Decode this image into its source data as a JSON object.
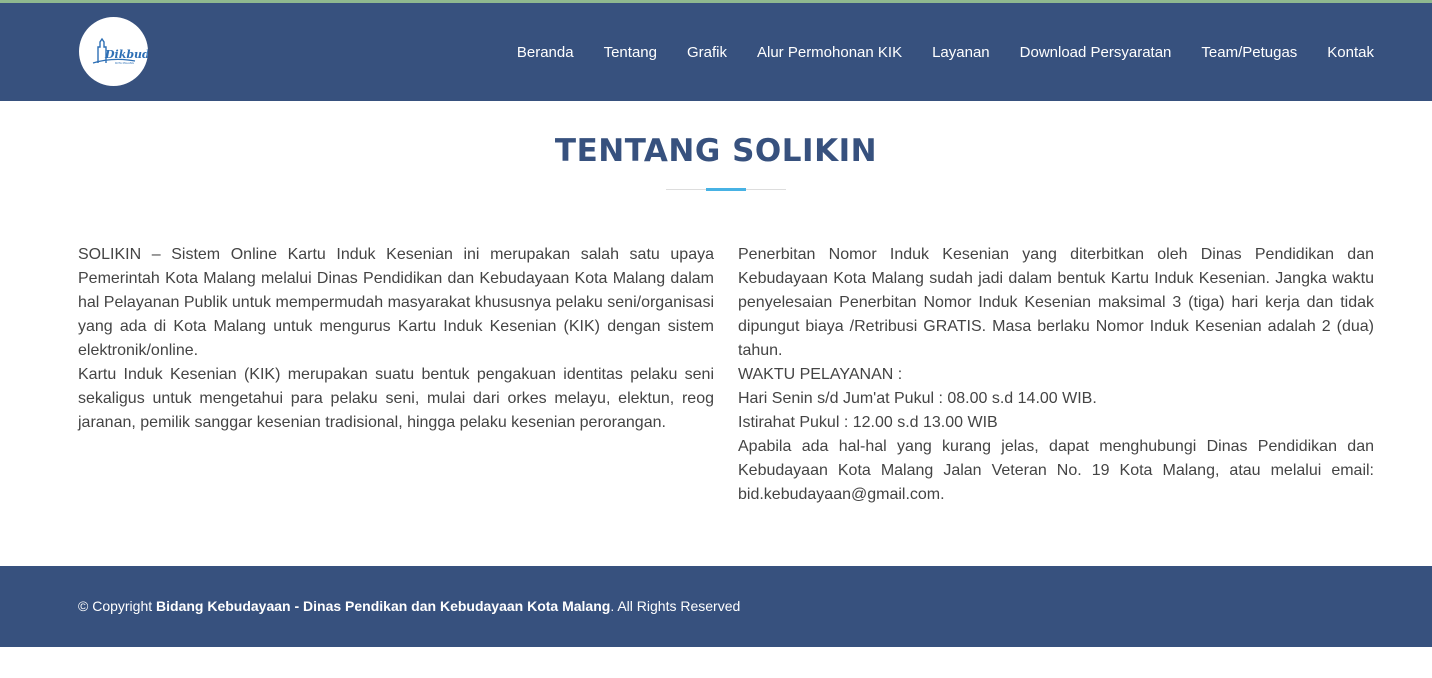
{
  "logo": {
    "text": "Dikbud",
    "subtext": "KOTA MALANG"
  },
  "nav": {
    "items": [
      "Beranda",
      "Tentang",
      "Grafik",
      "Alur Permohonan KIK",
      "Layanan",
      "Download Persyaratan",
      "Team/Petugas",
      "Kontak"
    ]
  },
  "section": {
    "title": "TENTANG SOLIKIN",
    "left": {
      "p1": "SOLIKIN – Sistem Online Kartu Induk Kesenian ini merupakan salah satu upaya Pemerintah Kota Malang melalui Dinas Pendidikan dan Kebudayaan Kota Malang dalam hal Pelayanan Publik untuk mempermudah masyarakat khususnya pelaku seni/organisasi yang ada di Kota Malang untuk mengurus Kartu Induk Kesenian (KIK) dengan sistem elektronik/online.",
      "p2": "Kartu Induk Kesenian (KIK) merupakan suatu bentuk pengakuan identitas pelaku seni sekaligus untuk mengetahui para pelaku seni, mulai dari orkes melayu, elektun, reog jaranan, pemilik sanggar kesenian tradisional, hingga pelaku kesenian perorangan."
    },
    "right": {
      "p1": "Penerbitan Nomor Induk Kesenian yang diterbitkan oleh Dinas Pendidikan dan Kebudayaan Kota Malang sudah jadi dalam bentuk Kartu Induk Kesenian. Jangka waktu penyelesaian Penerbitan Nomor Induk Kesenian maksimal 3 (tiga) hari kerja dan tidak dipungut biaya /Retribusi GRATIS. Masa berlaku Nomor Induk Kesenian adalah 2 (dua) tahun.",
      "p2": "WAKTU PELAYANAN :",
      "p3": "Hari Senin s/d Jum'at Pukul : 08.00 s.d 14.00 WIB.",
      "p4": "Istirahat Pukul : 12.00 s.d 13.00 WIB",
      "p5": "Apabila ada hal-hal yang kurang jelas, dapat menghubungi Dinas Pendidikan dan Kebudayaan Kota Malang Jalan Veteran No. 19 Kota Malang, atau melalui email: bid.kebudayaan@gmail.com."
    }
  },
  "footer": {
    "prefix": "© Copyright ",
    "org": "Bidang Kebudayaan - Dinas Pendikan dan Kebudayaan Kota Malang",
    "suffix": ". All Rights Reserved"
  },
  "colors": {
    "header_bg": "#37517e",
    "accent": "#47b2e4",
    "title": "#37517e",
    "body_text": "#444444"
  }
}
